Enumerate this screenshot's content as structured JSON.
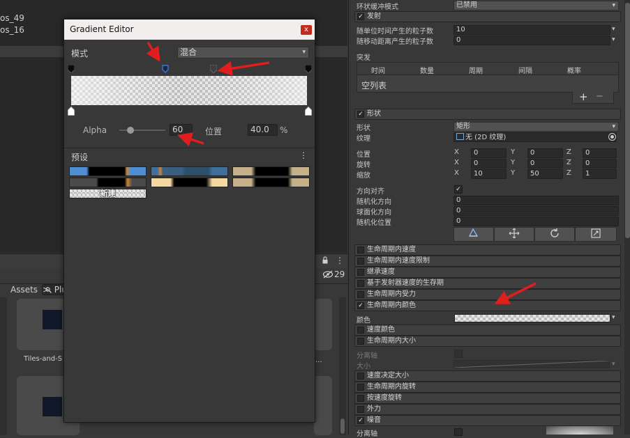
{
  "scene": {
    "line1": "os_49",
    "line2": "os_16"
  },
  "project": {
    "breadcrumb_root": "Assets",
    "breadcrumb_sep": ">",
    "breadcrumb_next": "Plug",
    "hidden_count": "29",
    "card1_label": "Tiles-and-S",
    "card2_label": "..."
  },
  "gradient_editor": {
    "title": "Gradient Editor",
    "close": "x",
    "mode_label": "模式",
    "mode_value": "混合",
    "alpha_label": "Alpha",
    "alpha_value": "60",
    "alpha_fraction": 0.24,
    "position_label": "位置",
    "position_value": "40.0",
    "percent": "%",
    "presets_label": "预设",
    "presets_menu": "⋮",
    "new_label": "新建"
  },
  "inspector": {
    "ring_buffer_label": "环状缓冲模式",
    "ring_buffer_value": "已禁用",
    "emission_title": "发射",
    "rate_time_label": "随单位时间产生的粒子数",
    "rate_time_value": "10",
    "rate_distance_label": "随移动距离产生的粒子数",
    "rate_distance_value": "0",
    "bursts_label": "突发",
    "bursts_columns": [
      "时间",
      "数量",
      "周期",
      "间隔",
      "概率"
    ],
    "bursts_empty": "空列表",
    "plus": "+",
    "minus": "−",
    "shape_title": "形状",
    "shape_label": "形状",
    "shape_value": "矩形",
    "texture_label": "纹理",
    "texture_value": "无 (2D 纹理)",
    "position_label": "位置",
    "rotation_label": "旋转",
    "scale_label": "缩放",
    "axis_x": "X",
    "axis_y": "Y",
    "axis_z": "Z",
    "position_values": [
      "0",
      "0",
      "0"
    ],
    "rotation_values": [
      "0",
      "0",
      "0"
    ],
    "scale_values": [
      "10",
      "50",
      "1"
    ],
    "align_direction_label": "方向对齐",
    "randomize_direction_label": "随机化方向",
    "randomize_direction_value": "0",
    "spherize_label": "球面化方向",
    "spherize_value": "0",
    "randomize_position_label": "随机化位置",
    "randomize_position_value": "0",
    "modules_a": [
      {
        "label": "生命周期内速度",
        "checked": false
      },
      {
        "label": "生命周期内速度限制",
        "checked": false
      },
      {
        "label": "继承速度",
        "checked": false
      },
      {
        "label": "基于发射器速度的生存期",
        "checked": false
      },
      {
        "label": "生命周期内受力",
        "checked": false
      },
      {
        "label": "生命周期内颜色",
        "checked": true
      }
    ],
    "color_label": "颜色",
    "modules_b": [
      {
        "label": "速度颜色",
        "checked": false
      },
      {
        "label": "生命周期内大小",
        "checked": false
      }
    ],
    "separate_axes_label": "分离轴",
    "size_label": "大小",
    "modules_c": [
      {
        "label": "速度决定大小",
        "checked": false
      },
      {
        "label": "生命周期内旋转",
        "checked": false
      },
      {
        "label": "按速度旋转",
        "checked": false
      },
      {
        "label": "外力",
        "checked": false
      },
      {
        "label": "噪音",
        "checked": true
      }
    ],
    "separate_axes_label2": "分离轴"
  },
  "icons": [
    "checkmark-icon",
    "dropdown-icon",
    "texture-icon",
    "target-icon",
    "lock-icon",
    "menu-icon",
    "eye-slash-icon",
    "search-icon",
    "edit-shape-icon",
    "move-icon",
    "rotate-icon",
    "scale-icon",
    "alpha-stop-icon",
    "color-stop-icon",
    "annotation-arrow"
  ],
  "colors": {
    "accent_blue": "#3a79d8",
    "arrow_red": "#e01e1e",
    "close_red": "#c42b1c"
  }
}
